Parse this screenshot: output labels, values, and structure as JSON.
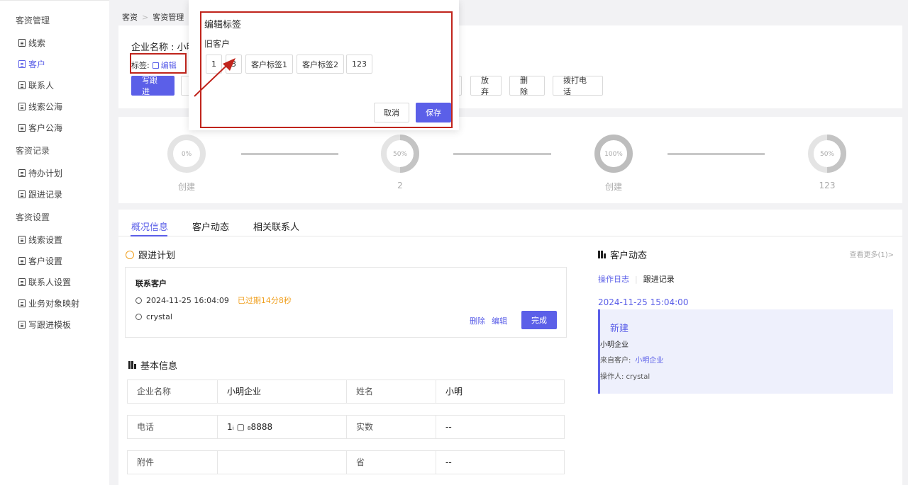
{
  "sidebar": {
    "groups": [
      {
        "title": "客资管理",
        "items": [
          "线索",
          "客户",
          "联系人",
          "线索公海",
          "客户公海"
        ]
      },
      {
        "title": "客资记录",
        "items": [
          "待办计划",
          "跟进记录"
        ]
      },
      {
        "title": "客资设置",
        "items": [
          "线索设置",
          "客户设置",
          "联系人设置",
          "业务对象映射",
          "写跟进模板"
        ]
      }
    ],
    "active_item": "客户"
  },
  "breadcrumb": [
    "客资",
    "客资管理"
  ],
  "header": {
    "company_label": "企业名称 : 小明",
    "tag_label": "标签:",
    "tag_edit": "编辑",
    "buttons": {
      "write_follow": "写跟进",
      "abandon": "放弃",
      "delete": "删除",
      "call": "拨打电话"
    }
  },
  "progress": {
    "steps": [
      {
        "percent_text": "0%",
        "percent": 0,
        "label": "创建"
      },
      {
        "percent_text": "50%",
        "percent": 50,
        "label": "2"
      },
      {
        "percent_text": "100%",
        "percent": 100,
        "label": "创建"
      },
      {
        "percent_text": "50%",
        "percent": 50,
        "label": "123"
      }
    ]
  },
  "tabs": [
    "概况信息",
    "客户动态",
    "相关联系人"
  ],
  "follow_plan": {
    "title": "跟进计划",
    "item_title": "联系客户",
    "time": "2024-11-25 16:04:09",
    "overdue": "已过期14分8秒",
    "user": "crystal",
    "actions": {
      "delete": "删除",
      "edit": "编辑",
      "done": "完成"
    }
  },
  "basic_info": {
    "title": "基本信息",
    "rows": [
      [
        "企业名称",
        "小明企业",
        "姓名",
        "小明"
      ],
      [
        "电话",
        "1ᵢ ▢ ₈8888",
        "实数",
        "--"
      ],
      [
        "附件",
        "",
        "省",
        "--"
      ]
    ]
  },
  "dynamics": {
    "title": "客户动态",
    "more": "查看更多(1)>",
    "tab_log": "操作日志",
    "tab_follow": "跟进记录",
    "date": "2024-11-25 15:04:00",
    "card_title": "新建",
    "card_company": "小明企业",
    "card_from_label": "来自客户:",
    "card_from_value": "小明企业",
    "card_operator": "操作人: crystal"
  },
  "modal": {
    "title": "编辑标签",
    "subtitle": "旧客户",
    "chips": [
      "1",
      "3",
      "客户标签1",
      "客户标签2",
      "123"
    ],
    "cancel": "取消",
    "save": "保存"
  },
  "colors": {
    "accent": "#5b5fe8",
    "warning": "#f0a020",
    "highlight_border": "#c0241c"
  }
}
